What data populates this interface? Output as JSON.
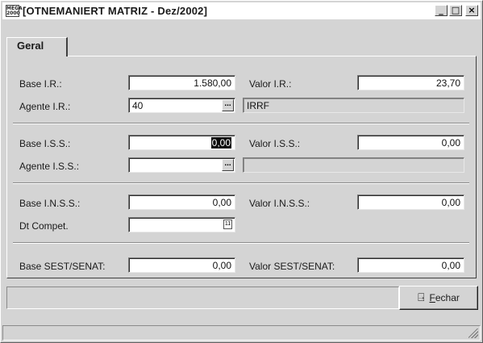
{
  "window": {
    "title": "[OTNEMANIERT MATRIZ - Dez/2002]",
    "icon_text_top": "MEGA",
    "icon_text_bottom": "2000",
    "minimize": "_",
    "maximize": "□",
    "close": "×"
  },
  "tabs": [
    {
      "label": "Geral",
      "active": true
    }
  ],
  "ir": {
    "base_label": "Base I.R.:",
    "base_value": "1.580,00",
    "valor_label": "Valor I.R.:",
    "valor_value": "23,70",
    "agente_label": "Agente I.R.:",
    "agente_value": "40",
    "agente_desc": "IRRF"
  },
  "iss": {
    "base_label": "Base I.S.S.:",
    "base_value": "0,00",
    "valor_label": "Valor I.S.S.:",
    "valor_value": "0,00",
    "agente_label": "Agente I.S.S.:",
    "agente_value": "",
    "agente_desc": ""
  },
  "inss": {
    "base_label": "Base I.N.S.S.:",
    "base_value": "0,00",
    "valor_label": "Valor I.N.S.S.:",
    "valor_value": "0,00",
    "dt_label": "Dt Compet.",
    "dt_value": ""
  },
  "sest": {
    "base_label": "Base SEST/SENAT:",
    "base_value": "0,00",
    "valor_label": "Valor SEST/SENAT:",
    "valor_value": "0,00"
  },
  "buttons": {
    "ellipsis": "...",
    "calendar": "11",
    "fechar_first": "F",
    "fechar_rest": "echar"
  },
  "icons": {
    "app": "mega2000-icon",
    "door": "exit-door-icon",
    "calendar": "calendar-icon"
  }
}
